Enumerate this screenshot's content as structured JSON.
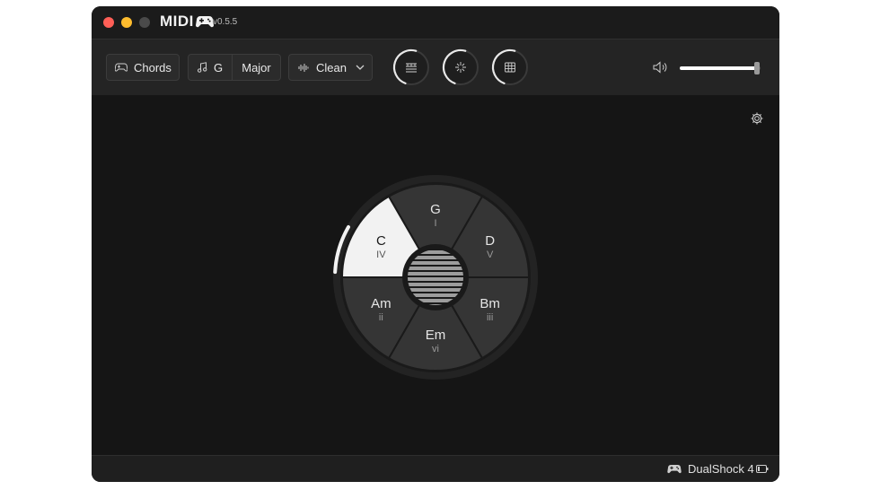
{
  "window": {
    "app_name": "MIDI",
    "version": "v0.5.5",
    "traffic_lights": {
      "close": "#ff5f57",
      "minimize": "#febc2e",
      "maximize": "#4a4a4a"
    }
  },
  "toolbar": {
    "mode_label": "Chords",
    "key_label": "G",
    "scale_label": "Major",
    "sound_label": "Clean",
    "knobs": [
      {
        "icon": "piano-keys-icon",
        "level": 0.55
      },
      {
        "icon": "sparkle-icon",
        "level": 0.55
      },
      {
        "icon": "grid-icon",
        "level": 0.55
      }
    ],
    "volume": 0.95
  },
  "chord_wheel": {
    "segments": [
      {
        "chord": "G",
        "numeral": "I"
      },
      {
        "chord": "D",
        "numeral": "V"
      },
      {
        "chord": "Bm",
        "numeral": "iii"
      },
      {
        "chord": "Em",
        "numeral": "vi"
      },
      {
        "chord": "Am",
        "numeral": "ii"
      },
      {
        "chord": "C",
        "numeral": "IV"
      }
    ],
    "active_index": 5,
    "active_color": "#f2f2f2",
    "segment_color": "#353535"
  },
  "statusbar": {
    "device_label": "DualShock 4"
  }
}
